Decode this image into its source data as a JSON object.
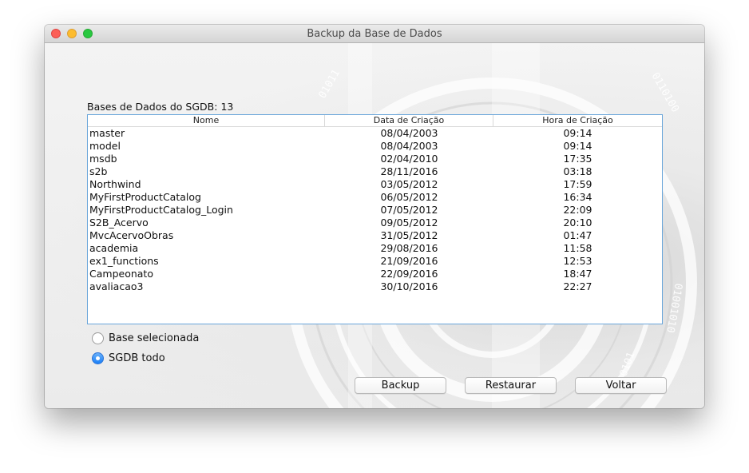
{
  "window": {
    "title": "Backup da Base de Dados"
  },
  "colors": {
    "selection_accent": "#1a7ff7",
    "table_border": "#6aa6da",
    "close": "#fc5f57",
    "minimize": "#fdbc2e",
    "maximize": "#28c840"
  },
  "databases": {
    "label": "Bases de Dados do SGDB: 13",
    "columns": [
      "Nome",
      "Data de Criação",
      "Hora de Criação"
    ],
    "rows": [
      [
        "master",
        "08/04/2003",
        "09:14"
      ],
      [
        "model",
        "08/04/2003",
        "09:14"
      ],
      [
        "msdb",
        "02/04/2010",
        "17:35"
      ],
      [
        "s2b",
        "28/11/2016",
        "03:18"
      ],
      [
        "Northwind",
        "03/05/2012",
        "17:59"
      ],
      [
        "MyFirstProductCatalog",
        "06/05/2012",
        "16:34"
      ],
      [
        "MyFirstProductCatalog_Login",
        "07/05/2012",
        "22:09"
      ],
      [
        "S2B_Acervo",
        "09/05/2012",
        "20:10"
      ],
      [
        "MvcAcervoObras",
        "31/05/2012",
        "01:47"
      ],
      [
        "academia",
        "29/08/2016",
        "11:58"
      ],
      [
        "ex1_functions",
        "21/09/2016",
        "12:53"
      ],
      [
        "Campeonato",
        "22/09/2016",
        "18:47"
      ],
      [
        "avaliacao3",
        "30/10/2016",
        "22:27"
      ]
    ]
  },
  "scope": {
    "options": [
      {
        "label": "Base selecionada",
        "selected": false
      },
      {
        "label": "SGDB todo",
        "selected": true
      }
    ]
  },
  "actions": {
    "backup": "Backup",
    "restore": "Restaurar",
    "back": "Voltar"
  }
}
